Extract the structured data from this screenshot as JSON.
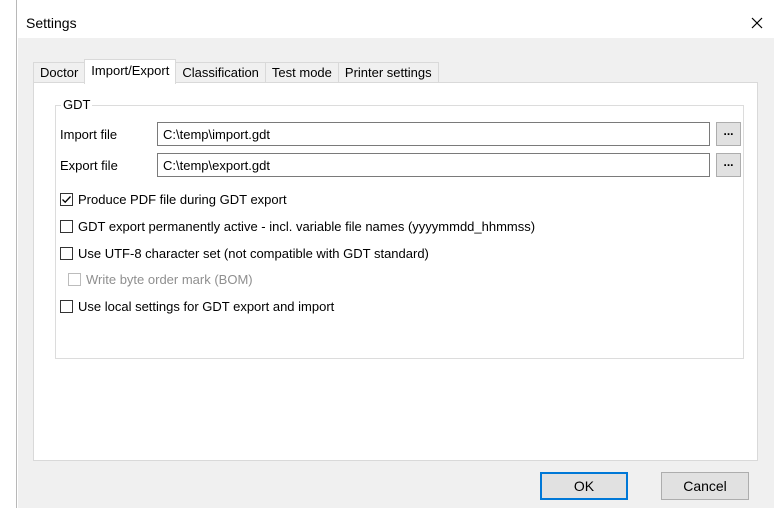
{
  "window": {
    "title": "Settings",
    "close_glyph": "✕"
  },
  "tabs": [
    {
      "label": "Doctor",
      "active": false
    },
    {
      "label": "Import/Export",
      "active": true
    },
    {
      "label": "Classification",
      "active": false
    },
    {
      "label": "Test mode",
      "active": false
    },
    {
      "label": "Printer settings",
      "active": false
    }
  ],
  "gdt_group": {
    "legend": "GDT",
    "import_file": {
      "label": "Import file",
      "value": "C:\\temp\\import.gdt",
      "browse_label": "..."
    },
    "export_file": {
      "label": "Export file",
      "value": "C:\\temp\\export.gdt",
      "browse_label": "..."
    },
    "options": [
      {
        "label": "Produce PDF file during GDT export",
        "checked": true,
        "enabled": true
      },
      {
        "label": "GDT export permanently active - incl. variable file names (yyyymmdd_hhmmss)",
        "checked": false,
        "enabled": true
      },
      {
        "label": "Use UTF-8 character set (not compatible with GDT standard)",
        "checked": false,
        "enabled": true
      },
      {
        "label": "Write byte order mark (BOM)",
        "checked": false,
        "enabled": false
      },
      {
        "label": "Use local settings for GDT export and import",
        "checked": false,
        "enabled": true
      }
    ]
  },
  "buttons": {
    "ok": "OK",
    "cancel": "Cancel"
  },
  "colors": {
    "accent": "#0078d7",
    "dialog_bg": "#f0f0f0",
    "panel_bg": "#ffffff",
    "disabled_text": "#8f8f8f"
  },
  "icons": {
    "close": "close-icon",
    "check": "checkmark-icon"
  }
}
